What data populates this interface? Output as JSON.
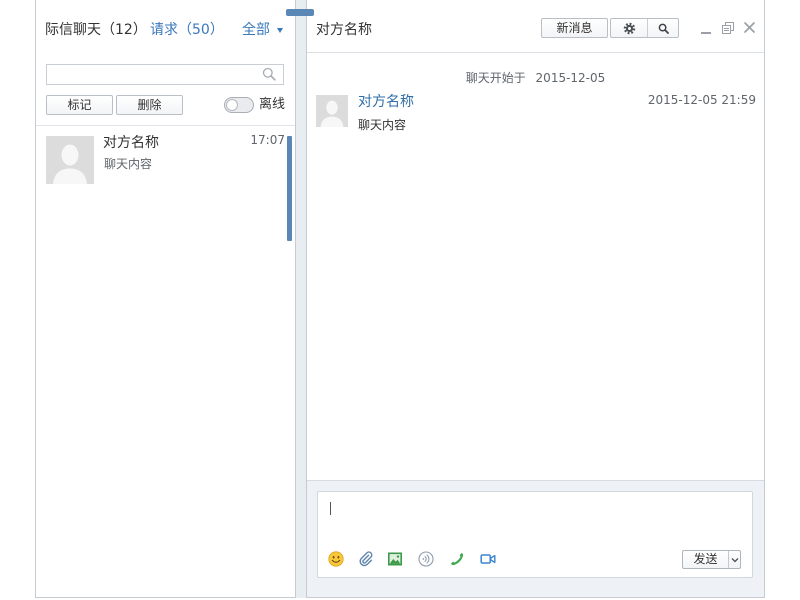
{
  "left_panel": {
    "title": "际信聊天（12）",
    "requests_link": "请求（50）",
    "filter": {
      "label": "全部",
      "icon": "caret-down-icon"
    },
    "search": {
      "value": "",
      "placeholder": "",
      "icon": "search-icon"
    },
    "actions": {
      "mark_label": "标记",
      "delete_label": "删除",
      "offline_label": "离线",
      "offline_enabled": false
    },
    "conversations": [
      {
        "name": "对方名称",
        "preview": "聊天内容",
        "time": "17:07",
        "avatar": "default-avatar-icon"
      }
    ]
  },
  "chat": {
    "title": "对方名称",
    "toolbar": {
      "new_message_label": "新消息",
      "settings_icon": "gear-icon",
      "search_icon": "search-icon"
    },
    "window_controls": [
      "minimize-icon",
      "restore-icon",
      "close-icon"
    ],
    "session_start": {
      "label": "聊天开始于",
      "date": "2015-12-05"
    },
    "messages": [
      {
        "sender": "对方名称",
        "timestamp": "2015-12-05 21:59",
        "text": "聊天内容",
        "avatar": "default-avatar-icon"
      }
    ],
    "composer": {
      "value": "",
      "tools": [
        "emoji-icon",
        "attachment-icon",
        "image-icon",
        "voice-icon",
        "phone-icon",
        "video-icon"
      ],
      "send_label": "发送",
      "send_menu_icon": "chevron-down-icon"
    }
  },
  "colors": {
    "accent": "#3a78bd",
    "sender_name": "#2f6ea8",
    "scrollbar": "#5b87b6",
    "border": "#c6cbd1",
    "composer_background": "#eef2f6",
    "divider_background": "#e8edf2"
  }
}
